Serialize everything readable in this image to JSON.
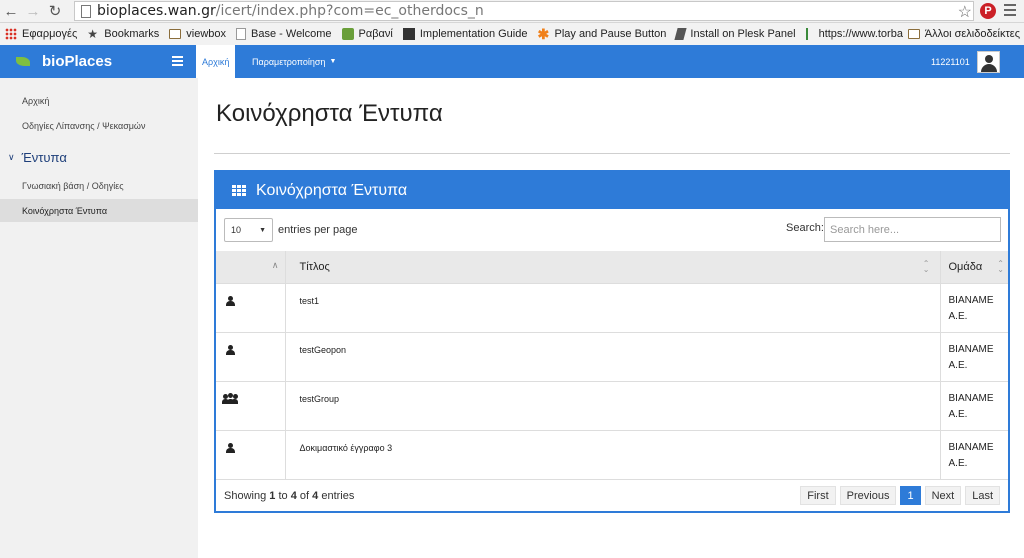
{
  "browser": {
    "url_host": "bioplaces.wan.gr",
    "url_path": "/icert/index.php?com=ec_otherdocs_n",
    "bookmarks": [
      {
        "label": "Εφαρμογές",
        "icon": "apps-icon"
      },
      {
        "label": "Bookmarks",
        "icon": "star-icon"
      },
      {
        "label": "viewbox",
        "icon": "folder-icon"
      },
      {
        "label": "Base - Welcome",
        "icon": "page-icon"
      },
      {
        "label": "Ραβανί",
        "icon": "site-icon"
      },
      {
        "label": "Implementation Guide",
        "icon": "doc-icon"
      },
      {
        "label": "Play and Pause Button",
        "icon": "asterisk-icon"
      },
      {
        "label": "Install on Plesk Panel",
        "icon": "plesk-icon"
      },
      {
        "label": "https://www.torbay.gc",
        "icon": "palm-icon"
      }
    ],
    "other_bookmarks": "Άλλοι σελιδοδείκτες"
  },
  "header": {
    "brand": "bioPlaces",
    "tabs": [
      "Αρχική",
      "Παραμετροποίηση"
    ],
    "user_id": "11221101"
  },
  "sidebar": {
    "items": [
      "Αρχική",
      "Οδηγίες Λίπανσης / Ψεκασμών"
    ],
    "section": "Έντυπα",
    "sub_items": [
      "Γνωσιακή βάση / Οδηγίες",
      "Κοινόχρηστα Έντυπα"
    ]
  },
  "main": {
    "title": "Κοινόχρηστα Έντυπα",
    "panel_title": "Κοινόχρηστα Έντυπα",
    "per_page_value": "10",
    "per_page_label": "entries per page",
    "search_label": "Search:",
    "search_placeholder": "Search here...",
    "columns": [
      "",
      "Τίτλος",
      "Ομάδα"
    ],
    "rows": [
      {
        "type": "user",
        "title": "test1",
        "group_line1": "BIANAME",
        "group_line2": "A.E."
      },
      {
        "type": "user",
        "title": "testGeopon",
        "group_line1": "BIANAME",
        "group_line2": "A.E."
      },
      {
        "type": "group",
        "title": "testGroup",
        "group_line1": "BIANAME",
        "group_line2": "A.E."
      },
      {
        "type": "user",
        "title": "Δοκιμαστικό έγγραφο 3",
        "group_line1": "BIANAME",
        "group_line2": "A.E."
      }
    ],
    "showing": {
      "prefix": "Showing",
      "from": "1",
      "to_word": "to",
      "to": "4",
      "of_word": "of",
      "total": "4",
      "suffix": "entries"
    },
    "pager": [
      "First",
      "Previous",
      "1",
      "Next",
      "Last"
    ]
  },
  "colors": {
    "accent": "#2e7bd8",
    "sidebar_bg": "#f1f1f1",
    "section_text": "#1e3f7a"
  }
}
